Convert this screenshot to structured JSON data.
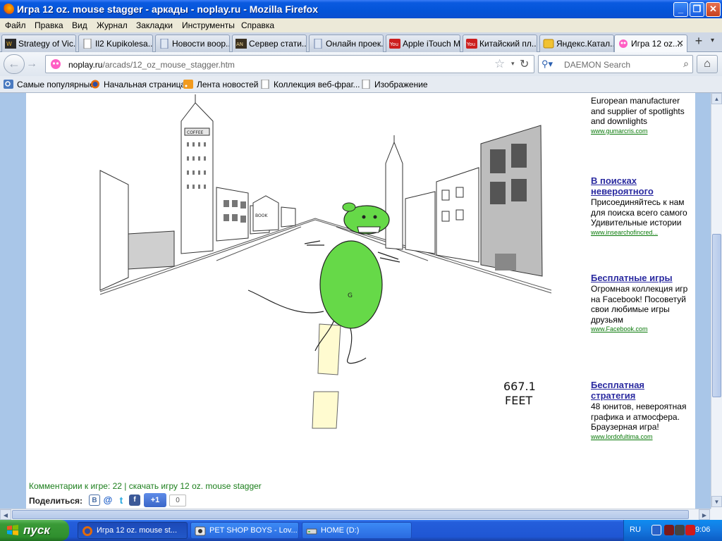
{
  "window": {
    "title": "Игра 12 oz. mouse stagger - аркады - noplay.ru - Mozilla Firefox",
    "minimize": "_",
    "maximize": "❐",
    "close": "✕"
  },
  "menu": [
    "Файл",
    "Правка",
    "Вид",
    "Журнал",
    "Закладки",
    "Инструменты",
    "Справка"
  ],
  "tabs": [
    {
      "label": "Strategy of Vic...",
      "icon": "game-tab-icon"
    },
    {
      "label": "Il2 Kupikolesa....",
      "icon": "page-tab-icon"
    },
    {
      "label": "Новости воор...",
      "icon": "page-tab-icon"
    },
    {
      "label": "Сервер стати...",
      "icon": "page-tab-icon"
    },
    {
      "label": "Онлайн проек...",
      "icon": "page-tab-icon"
    },
    {
      "label": "Apple iTouch M...",
      "icon": "youtube-icon"
    },
    {
      "label": "Китайский пл...",
      "icon": "youtube-icon"
    },
    {
      "label": "Яндекс.Катал...",
      "icon": "yandex-icon"
    },
    {
      "label": "Игра 12 oz....",
      "icon": "noplay-icon",
      "close": "✕"
    }
  ],
  "new_tab": "+",
  "tab_list": "▾",
  "nav": {
    "back": "←",
    "forward": "→",
    "url_host": "noplay.ru",
    "url_path": "/arcads/12_oz_mouse_stagger.htm",
    "star": "☆",
    "dropdown": "▾",
    "reload": "↻",
    "search_engine_icon": "⚲▾",
    "search_placeholder": "DAEMON Search",
    "search_go": "⌕",
    "home": "⌂"
  },
  "bookmarks": [
    {
      "label": "Самые популярные",
      "icon": "most-visited-icon"
    },
    {
      "label": "Начальная страница",
      "icon": "firefox-icon"
    },
    {
      "label": "Лента новостей",
      "icon": "rss-icon"
    },
    {
      "label": "Коллекция веб-фраг...",
      "icon": "page-icon"
    },
    {
      "label": "Изображение",
      "icon": "page-icon"
    }
  ],
  "game": {
    "distance": "667.1",
    "unit": "FEET",
    "sign1": "COFFEE",
    "sign2": "BOOK"
  },
  "ads": [
    {
      "title": "",
      "body": "European manufacturer and supplier of spotlights and downlights",
      "url": "www.gumarcris.com"
    },
    {
      "title": "В поисках невероятного",
      "body": "Присоединяйтесь к нам для поиска всего самого Удивительные истории",
      "url": "www.insearchofincred..."
    },
    {
      "title": "Бесплатные игры",
      "body": "Огромная коллекция игр на Facebook! Посоветуй свои любимые игры друзьям",
      "url": "www.Facebook.com"
    },
    {
      "title": "Бесплатная стратегия",
      "body": "48 юнитов, невероятная графика и атмосфера. Браузерная игра!",
      "url": "www.lordofultima.com"
    }
  ],
  "footer": {
    "comments": "Комментарии к игре: 22",
    "separator": "|",
    "download": "скачать игру 12 oz. mouse stagger",
    "share": "Поделиться:",
    "share_icons": [
      "В",
      "@",
      "t",
      "f"
    ],
    "plus_one": "+1",
    "plus_count": "0"
  },
  "scroll": {
    "up": "▲",
    "down": "▼",
    "left": "◀",
    "right": "▶"
  },
  "taskbar": {
    "start": "пуск",
    "tasks": [
      {
        "label": "Игра 12 oz. mouse st...",
        "active": true
      },
      {
        "label": "PET SHOP BOYS - Lov...",
        "active": false
      },
      {
        "label": "HOME (D:)",
        "active": false
      }
    ],
    "lang": "RU",
    "clock": "9:06"
  }
}
